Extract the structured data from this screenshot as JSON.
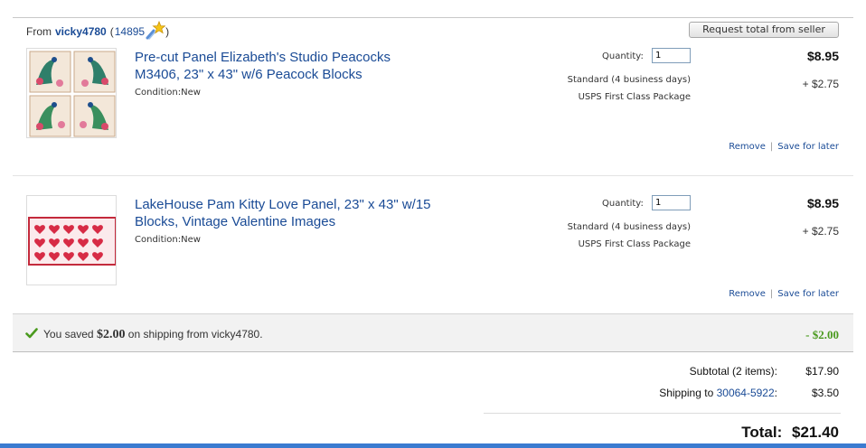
{
  "seller": {
    "from_label": "From",
    "name": "vicky4780",
    "open_paren": "(",
    "score": "14895",
    "close_paren": ")",
    "star_icon": "shooting-star-icon"
  },
  "request_total_button": "Request total from seller",
  "items": [
    {
      "title_line1": "Pre-cut Panel Elizabeth's Studio Peacocks",
      "title_line2": "M3406, 23\" x 43\" w/6 Peacock Blocks",
      "condition_label": "Condition:",
      "condition_value": "New",
      "quantity_label": "Quantity:",
      "quantity_value": "1",
      "price": "$8.95",
      "shipping_service": "Standard (4 business days)",
      "shipping_carrier": "USPS First Class Package",
      "shipping_cost": "+ $2.75",
      "remove_label": "Remove",
      "separator": "|",
      "save_label": "Save for later"
    },
    {
      "title_line1": "LakeHouse Pam Kitty Love Panel, 23\" x 43\" w/15",
      "title_line2": "Blocks, Vintage Valentine Images",
      "condition_label": "Condition:",
      "condition_value": "New",
      "quantity_label": "Quantity:",
      "quantity_value": "1",
      "price": "$8.95",
      "shipping_service": "Standard (4 business days)",
      "shipping_carrier": "USPS First Class Package",
      "shipping_cost": "+ $2.75",
      "remove_label": "Remove",
      "separator": "|",
      "save_label": "Save for later"
    }
  ],
  "savings": {
    "prefix": "You saved",
    "amount": "$2.00",
    "suffix": "on shipping from vicky4780.",
    "discount": "- $2.00",
    "color": "#4a9a1e"
  },
  "summary": {
    "subtotal_label": "Subtotal (2 items):",
    "subtotal_value": "$17.90",
    "shipping_label": "Shipping to",
    "shipping_zip": "30064-5922",
    "shipping_colon": ":",
    "shipping_value": "$3.50",
    "total_label": "Total:",
    "total_value": "$21.40"
  },
  "colors": {
    "link": "#1a4b96",
    "bottom_bar": "#3b7bd0"
  }
}
